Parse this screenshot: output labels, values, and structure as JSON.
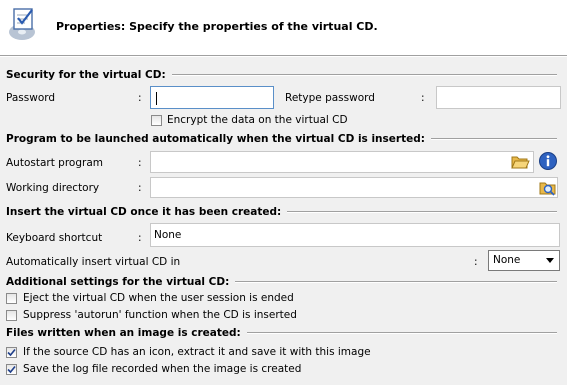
{
  "header": {
    "title": "Properties: Specify the properties of the virtual CD."
  },
  "security": {
    "title": "Security for the virtual CD:",
    "password_label": "Password",
    "colon": ":",
    "password_value": "",
    "retype_label": "Retype password",
    "retype_value": "",
    "encrypt_label": "Encrypt the data on the virtual CD",
    "encrypt_checked": false
  },
  "program": {
    "title": "Program to be launched automatically when the virtual CD is inserted:",
    "autostart_label": "Autostart program",
    "autostart_value": "",
    "workdir_label": "Working directory",
    "workdir_value": ""
  },
  "insert": {
    "title": "Insert the virtual CD once it has been created:",
    "shortcut_label": "Keyboard shortcut",
    "shortcut_value": "None",
    "auto_insert_label": "Automatically insert virtual CD in",
    "auto_insert_selected": "None"
  },
  "additional": {
    "title": "Additional settings for the virtual CD:",
    "eject_label": "Eject the virtual CD when the user session is ended",
    "eject_checked": false,
    "suppress_label": "Suppress 'autorun' function when the CD is inserted",
    "suppress_checked": false
  },
  "files": {
    "title": "Files written when an image is created:",
    "extract_icon_label": "If the source CD has an icon, extract it and save it with this image",
    "extract_icon_checked": true,
    "save_log_label": "Save the log file recorded when the image is created",
    "save_log_checked": true
  },
  "icons": {
    "header": "virtual-cd-properties-icon",
    "browse_file": "folder-open-icon",
    "info": "info-icon",
    "browse_folder": "folder-search-icon"
  }
}
